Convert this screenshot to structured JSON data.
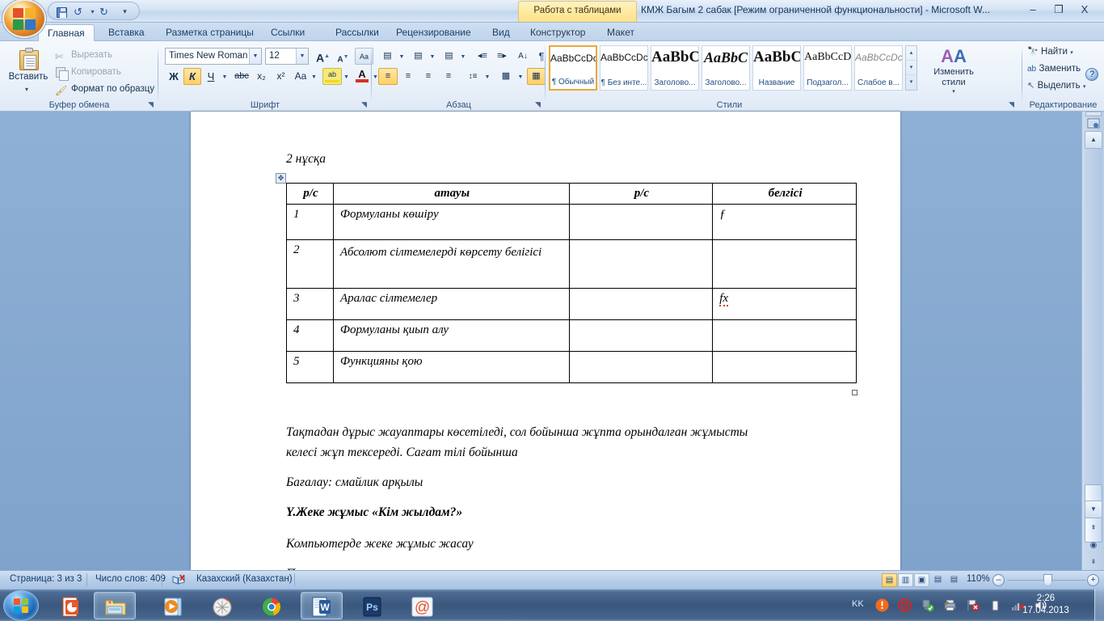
{
  "window": {
    "title": "КМЖ Багым 2 сабак [Режим ограниченной функциональности] - Microsoft W...",
    "contextual_tab_header": "Работа с таблицами",
    "minimize": "–",
    "maximize": "❐",
    "close": "X",
    "help": "?"
  },
  "quick_access": {
    "save": "save-icon",
    "undo": "↺",
    "undo_dropdown": "▾",
    "redo": "↻",
    "customize": "▾"
  },
  "ribbon": {
    "tabs": [
      {
        "label": "Главная",
        "active": true
      },
      {
        "label": "Вставка",
        "active": false
      },
      {
        "label": "Разметка страницы",
        "active": false
      },
      {
        "label": "Ссылки",
        "active": false
      },
      {
        "label": "Рассылки",
        "active": false
      },
      {
        "label": "Рецензирование",
        "active": false
      },
      {
        "label": "Вид",
        "active": false
      },
      {
        "label": "Конструктор",
        "active": false
      },
      {
        "label": "Макет",
        "active": false
      }
    ],
    "clipboard": {
      "group_label": "Буфер обмена",
      "paste": "Вставить",
      "paste_arrow": "▾",
      "cut": "Вырезать",
      "copy": "Копировать",
      "format_painter": "Формат по образцу",
      "dialog_launcher": "◥"
    },
    "font": {
      "group_label": "Шрифт",
      "font_name": "Times New Roman",
      "font_size": "12",
      "grow_font": "A",
      "shrink_font": "A",
      "clear_formatting": "Aa",
      "bold": "Ж",
      "italic": "К",
      "underline": "Ч",
      "strikethrough": "abc",
      "subscript": "x₂",
      "superscript": "x²",
      "change_case": "Aa",
      "highlight": "ab",
      "font_color": "A",
      "dialog_launcher": "◥"
    },
    "paragraph": {
      "group_label": "Абзац",
      "bullets": "▤",
      "numbering": "▤",
      "multilevel": "▤",
      "decrease_indent": "◂≡",
      "increase_indent": "≡▸",
      "sort": "A↓",
      "show_marks": "¶",
      "align_left": "≡",
      "align_center": "≡",
      "align_right": "≡",
      "justify": "≡",
      "line_spacing": "↕≡",
      "shading": "▩",
      "borders": "▦",
      "dialog_launcher": "◥"
    },
    "styles": {
      "group_label": "Стили",
      "change_styles": "Изменить стили",
      "change_styles_arrow": "▾",
      "dialog_launcher": "◥",
      "items": [
        {
          "preview": "AaBbCcDc",
          "name": "¶ Обычный",
          "selected": true
        },
        {
          "preview": "AaBbCcDc",
          "name": "¶ Без инте...",
          "selected": false
        },
        {
          "preview": "AaBbC",
          "name": "Заголово...",
          "selected": false
        },
        {
          "preview": "AaBbC",
          "name": "Заголово...",
          "selected": false
        },
        {
          "preview": "AaBbC",
          "name": "Название",
          "selected": false
        },
        {
          "preview": "AaBbCcD",
          "name": "Подзагол...",
          "selected": false
        },
        {
          "preview": "AaBbCcDc",
          "name": "Слабое в...",
          "selected": false
        }
      ],
      "scroll_up": "▴",
      "scroll_down": "▾",
      "more": "▾"
    },
    "editing": {
      "group_label": "Редактирование",
      "find": "Найти",
      "find_arrow": "▾",
      "replace": "Заменить",
      "select": "Выделить",
      "select_arrow": "▾"
    }
  },
  "document": {
    "heading": "2 нұсқа",
    "table_move_handle": "✥",
    "table": {
      "headers": [
        "р/с",
        "атауы",
        "р/с",
        "белгісі"
      ],
      "rows": [
        {
          "num": "1",
          "name": "Формуланы көшіру",
          "ps": "",
          "sign": "ƒ"
        },
        {
          "num": "2",
          "name": "Абсолют сілтемелерді көрсету белігісі",
          "ps": "",
          "sign": ""
        },
        {
          "num": "3",
          "name": "Аралас сілтемелер",
          "ps": "",
          "sign": "fx"
        },
        {
          "num": "4",
          "name": "Формуланы қиып алу",
          "ps": "",
          "sign": ""
        },
        {
          "num": "5",
          "name": "Функцияны қою",
          "ps": "",
          "sign": ""
        }
      ]
    },
    "paragraphs": [
      {
        "text": "Тақтадан дұрыс жауаптары көсетіледі, сол бойынша жұпта орындалған жұмысты",
        "bold": false
      },
      {
        "text": "келесі жұп тексереді. Сағат тілі бойынша",
        "bold": false
      },
      {
        "text": "Бағалау: смайлик арқылы",
        "bold": false
      },
      {
        "text": "Y.Жеке жұмыс «Кім жылдам?»",
        "bold": true
      },
      {
        "text": "Компьютерде жеке жұмыс жасау",
        "bold": false
      }
    ]
  },
  "scrollbar": {
    "split": "split-handle",
    "up_arrow": "▲",
    "down_arrow": "▼",
    "prev_object": "⇞",
    "select_object": "◉",
    "next_object": "⇟"
  },
  "statusbar": {
    "page": "Страница: 3 из 3",
    "words": "Число слов: 409",
    "proofing": "proofing-icon",
    "language": "Казахский (Казахстан)",
    "views": [
      {
        "name": "print-layout",
        "glyph": "▤",
        "active": true
      },
      {
        "name": "full-screen-reading",
        "glyph": "▥",
        "active": false
      },
      {
        "name": "web-layout",
        "glyph": "▣",
        "active": false
      },
      {
        "name": "outline",
        "glyph": "▤",
        "active": false
      },
      {
        "name": "draft",
        "glyph": "▤",
        "active": false
      }
    ],
    "zoom": "110%",
    "zoom_out": "–",
    "zoom_in": "+"
  },
  "taskbar": {
    "start": "start-orb",
    "items": [
      {
        "name": "powerpoint",
        "active": false
      },
      {
        "name": "explorer",
        "active": true
      },
      {
        "name": "media-player",
        "active": false
      },
      {
        "name": "firefox",
        "active": false
      },
      {
        "name": "chrome",
        "active": false
      },
      {
        "name": "word",
        "active": true
      },
      {
        "name": "photoshop",
        "active": false
      },
      {
        "name": "mail",
        "active": false
      }
    ],
    "tray": {
      "language": "KK",
      "icons": [
        "action-center-alert",
        "antivirus",
        "network-shield",
        "printer",
        "flag-error",
        "battery",
        "signal-disconnected",
        "volume"
      ],
      "time": "2:26",
      "date": "17.04.2013"
    }
  },
  "colors": {
    "accent": "#e8a93c",
    "ribbon_text": "#1b3e68",
    "title_text": "#12355c",
    "contextual": "#ffe89a"
  }
}
